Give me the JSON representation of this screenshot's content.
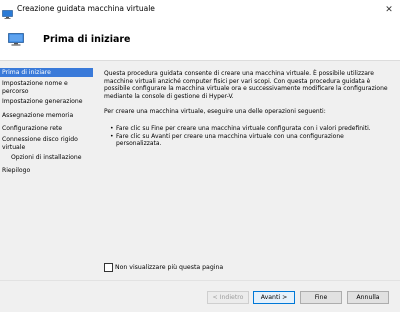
{
  "window": {
    "title": "Creazione guidata macchina virtuale",
    "close_glyph": "✕"
  },
  "header": {
    "title": "Prima di iniziare"
  },
  "sidebar": {
    "items": [
      {
        "label": "Prima di iniziare"
      },
      {
        "label": "Impostazione nome e percorso"
      },
      {
        "label": "Impostazione generazione"
      },
      {
        "label": "Assegnazione memoria"
      },
      {
        "label": "Configurazione rete"
      },
      {
        "label": "Connessione disco rigido virtuale"
      },
      {
        "label": "Opzioni di installazione"
      },
      {
        "label": "Riepilogo"
      }
    ]
  },
  "content": {
    "paragraph1": "Questa procedura guidata consente di creare una macchina virtuale. È possibile utilizzare macchine virtuali anziché computer fisici per vari scopi. Con questa procedura guidata è possibile configurare la macchina virtuale ora e successivamente modificare la configurazione mediante la console di gestione di Hyper-V.",
    "paragraph2": "Per creare una macchina virtuale, eseguire una delle operazioni seguenti:",
    "bullets": [
      "Fare clic su Fine per creare una macchina virtuale configurata con i valori predefiniti.",
      "Fare clic su Avanti per creare una macchina virtuale con una configurazione personalizzata."
    ]
  },
  "checkbox": {
    "label": "Non visualizzare più questa pagina",
    "checked": false
  },
  "buttons": {
    "back": "< Indietro",
    "next": "Avanti >",
    "finish": "Fine",
    "cancel": "Annulla"
  },
  "colors": {
    "selection": "#3a7ad9",
    "default_button_border": "#0078d7"
  },
  "icons": {
    "app": "hyper-v-monitor-icon",
    "header": "monitor-icon"
  }
}
